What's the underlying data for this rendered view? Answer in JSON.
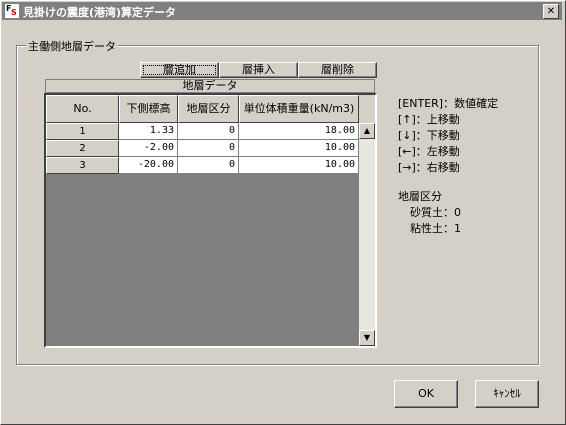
{
  "window": {
    "title": "見掛けの震度(港湾)算定データ",
    "close_glyph": "✕"
  },
  "group": {
    "label": "主働側地層データ"
  },
  "toolbar": {
    "add_label": "層追加",
    "insert_label": "層挿入",
    "delete_label": "層削除"
  },
  "grid": {
    "caption": "地層データ",
    "headers": [
      "No.",
      "下側標高",
      "地層区分",
      "単位体積重量(kN/m3)"
    ],
    "rows": [
      {
        "no": "1",
        "elevation": "1.33",
        "class": "0",
        "weight": "18.00"
      },
      {
        "no": "2",
        "elevation": "-2.00",
        "class": "0",
        "weight": "10.00"
      },
      {
        "no": "3",
        "elevation": "-20.00",
        "class": "0",
        "weight": "10.00"
      }
    ]
  },
  "help": {
    "keys": [
      "[ENTER]：数値確定",
      "[↑]：上移動",
      "[↓]：下移動",
      "[←]：左移動",
      "[→]：右移動"
    ],
    "legend_title": "地層区分",
    "legend_items": [
      "砂質土：0",
      "粘性土：1"
    ]
  },
  "footer": {
    "ok_label": "OK",
    "cancel_label": "ｷｬﾝｾﾙ"
  }
}
